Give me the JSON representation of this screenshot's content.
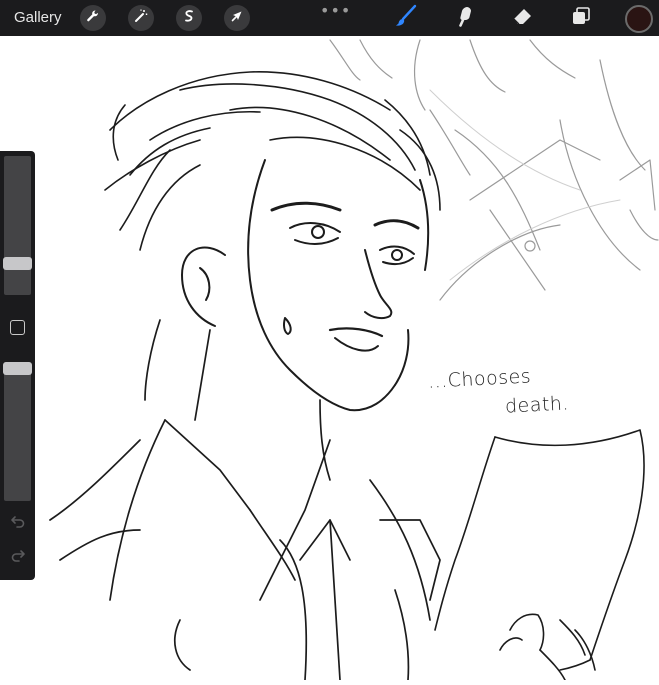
{
  "topbar": {
    "gallery_label": "Gallery",
    "left_tools": [
      {
        "name": "actions",
        "icon": "wrench-icon"
      },
      {
        "name": "adjustments",
        "icon": "magic-wand-icon"
      },
      {
        "name": "selection",
        "icon": "selection-icon"
      },
      {
        "name": "transform",
        "icon": "arrow-cursor-icon"
      }
    ],
    "more_label": "•••",
    "right_tools": [
      {
        "name": "brush",
        "icon": "brush-icon",
        "active": true,
        "color": "#2f86ff"
      },
      {
        "name": "smudge",
        "icon": "smudge-icon",
        "active": false
      },
      {
        "name": "eraser",
        "icon": "eraser-icon",
        "active": false
      },
      {
        "name": "layers",
        "icon": "layers-icon",
        "active": false
      }
    ],
    "current_color": "#2a1413"
  },
  "canvas": {
    "annotation_line1": "...Chooses",
    "annotation_line2": "death."
  },
  "sidebar": {
    "brush_size_level": 0.2,
    "opacity_level": 1.0,
    "modify_icon": "square-icon",
    "undo_icon": "undo-icon",
    "redo_icon": "redo-icon"
  }
}
